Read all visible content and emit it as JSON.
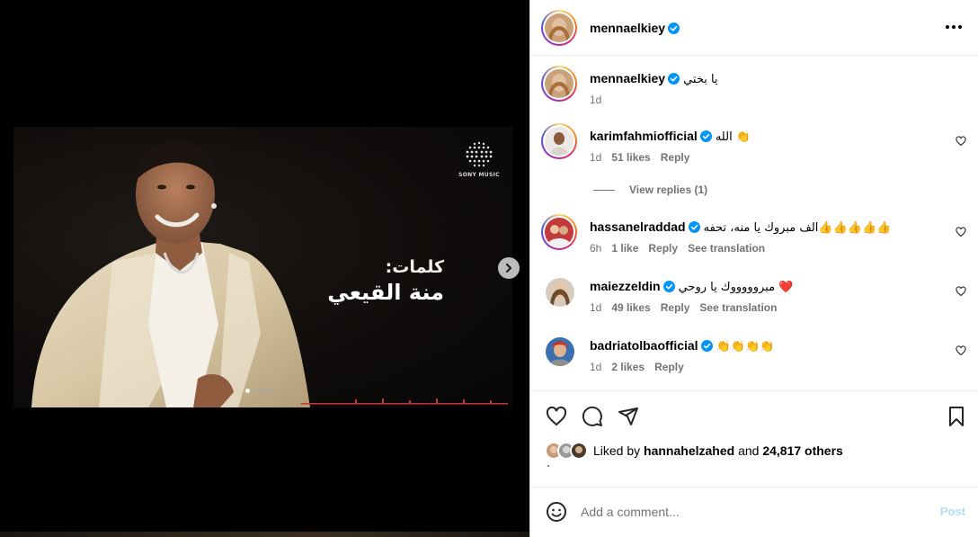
{
  "media": {
    "lyrics_label": "كلمات:",
    "lyrics_name": "منة القيعي",
    "label_brand": "SONY MUSIC",
    "carousel": {
      "count": 4,
      "active": 1
    }
  },
  "header": {
    "username": "mennaelkiey",
    "verified": true
  },
  "caption": {
    "username": "mennaelkiey",
    "text": "يا بختي",
    "time": "1d"
  },
  "comments": [
    {
      "username": "karimfahmiofficial",
      "text": "الله 👏",
      "time": "1d",
      "likes": "51 likes",
      "reply": "Reply",
      "translate": "",
      "view_replies": "View replies (1)"
    },
    {
      "username": "hassanelraddad",
      "text": "الف مبروك يا منه، تحفه👍👍👍👍👍",
      "time": "6h",
      "likes": "1 like",
      "reply": "Reply",
      "translate": "See translation"
    },
    {
      "username": "maiezzeldin",
      "text": "مبروووووك يا روحي ❤️",
      "time": "1d",
      "likes": "49 likes",
      "reply": "Reply",
      "translate": "See translation"
    },
    {
      "username": "badriatolbaofficial",
      "text": "👏👏👏👏",
      "time": "1d",
      "likes": "2 likes",
      "reply": "Reply",
      "translate": ""
    }
  ],
  "likes": {
    "prefix": "Liked by ",
    "user": "hannahelzahed",
    "middle": " and ",
    "others": "24,817 others"
  },
  "comment_box": {
    "placeholder": "Add a comment...",
    "post_label": "Post"
  },
  "colors": {
    "verified": "#0095f6",
    "post_disabled": "#b3dbff",
    "meta": "#737373"
  }
}
